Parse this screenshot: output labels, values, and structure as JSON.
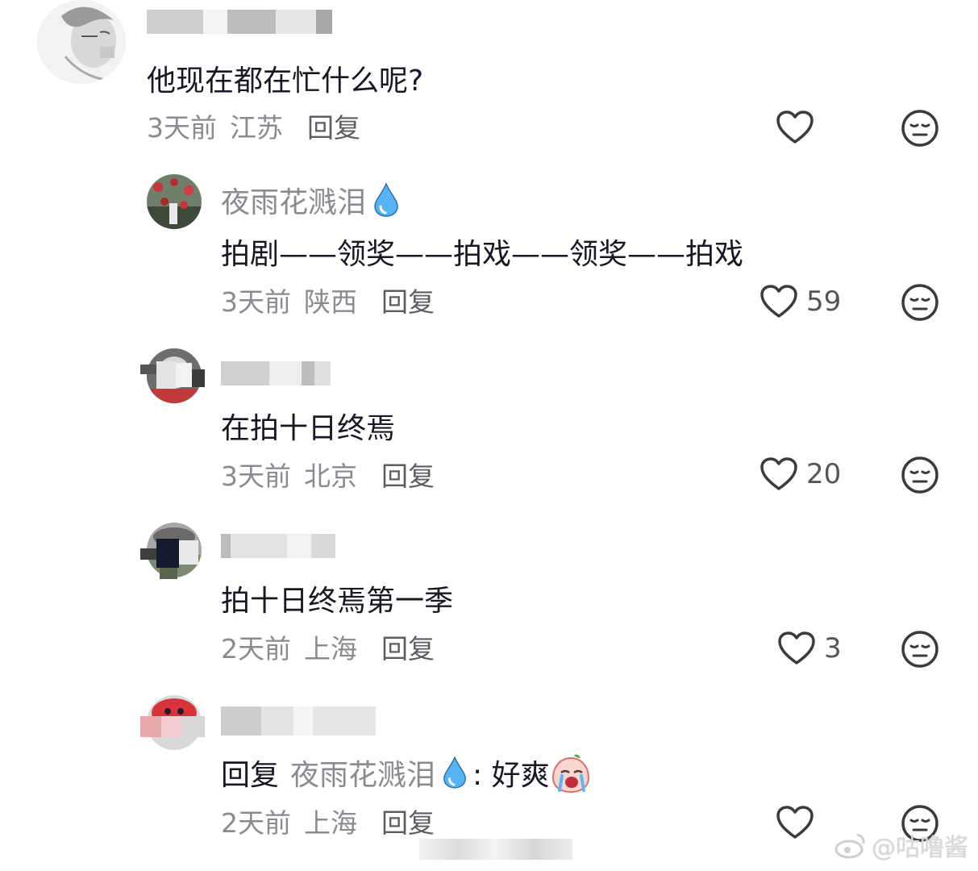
{
  "comments": [
    {
      "username": "",
      "text": "他现在都在忙什么呢?",
      "time": "3天前",
      "location": "江苏",
      "reply_label": "回复",
      "likes": ""
    },
    {
      "username": "夜雨花溅泪",
      "text": "拍剧——领奖——拍戏——领奖——拍戏",
      "time": "3天前",
      "location": "陕西",
      "reply_label": "回复",
      "likes": "59"
    },
    {
      "username": "",
      "text": "在拍十日终焉",
      "time": "3天前",
      "location": "北京",
      "reply_label": "回复",
      "likes": "20"
    },
    {
      "username": "",
      "text": "拍十日终焉第一季",
      "time": "2天前",
      "location": "上海",
      "reply_label": "回复",
      "likes": "3"
    },
    {
      "username": "",
      "reply_prefix": "回复",
      "mention": "夜雨花溅泪",
      "text": ": 好爽",
      "time": "2天前",
      "location": "上海",
      "reply_label": "回复",
      "likes": ""
    }
  ],
  "watermark": "@咕噜酱",
  "colors": {
    "primary_text": "#161823",
    "secondary_text": "#8a8b91",
    "icon": "#3a3b40",
    "drop": "#3aa0f0"
  },
  "icons": [
    "heart-icon",
    "dislike-face-icon",
    "water-drop-icon",
    "crying-emoji-icon",
    "weibo-logo"
  ]
}
